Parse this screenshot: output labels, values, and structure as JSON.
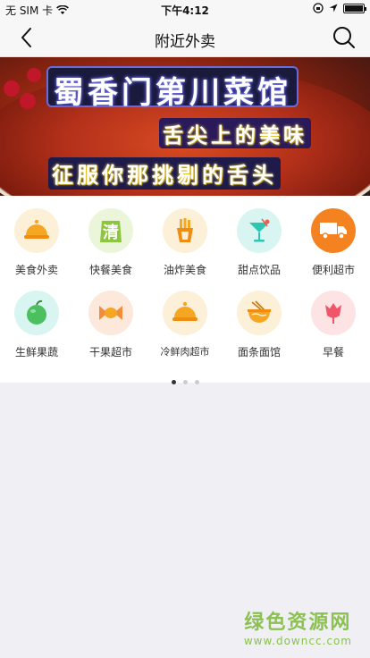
{
  "status_bar": {
    "carrier": "无 SIM 卡",
    "time": "下午4:12",
    "battery_level": 1.0
  },
  "nav": {
    "title": "附近外卖",
    "back_icon": "chevron-left-icon",
    "search_icon": "search-icon"
  },
  "banner": {
    "line1": "蜀香门第川菜馆",
    "line2": "舌尖上的美味",
    "line3": "征服你那挑剔的舌头"
  },
  "categories": [
    {
      "label": "美食外卖",
      "icon": "cloche-icon",
      "bg": "#fdf0d9"
    },
    {
      "label": "快餐美食",
      "icon": "qing-badge-icon",
      "bg": "#eaf5d9"
    },
    {
      "label": "油炸美食",
      "icon": "fries-icon",
      "bg": "#fdf0d9"
    },
    {
      "label": "甜点饮品",
      "icon": "cocktail-icon",
      "bg": "#d9f5f1"
    },
    {
      "label": "便利超市",
      "icon": "truck-icon",
      "bg": "#f58220"
    },
    {
      "label": "生鲜果蔬",
      "icon": "apple-icon",
      "bg": "#d9f5f1"
    },
    {
      "label": "干果超市",
      "icon": "candy-icon",
      "bg": "#fde8dc"
    },
    {
      "label": "冷鲜肉超市",
      "icon": "cloche-icon",
      "bg": "#fdf0d9"
    },
    {
      "label": "面条面馆",
      "icon": "noodle-bowl-icon",
      "bg": "#fdf0d9"
    },
    {
      "label": "早餐",
      "icon": "tulip-icon",
      "bg": "#fde3e3"
    }
  ],
  "pager": {
    "count": 3,
    "active": 1
  },
  "watermark": {
    "title": "绿色资源网",
    "url": "www.downcc.com"
  }
}
